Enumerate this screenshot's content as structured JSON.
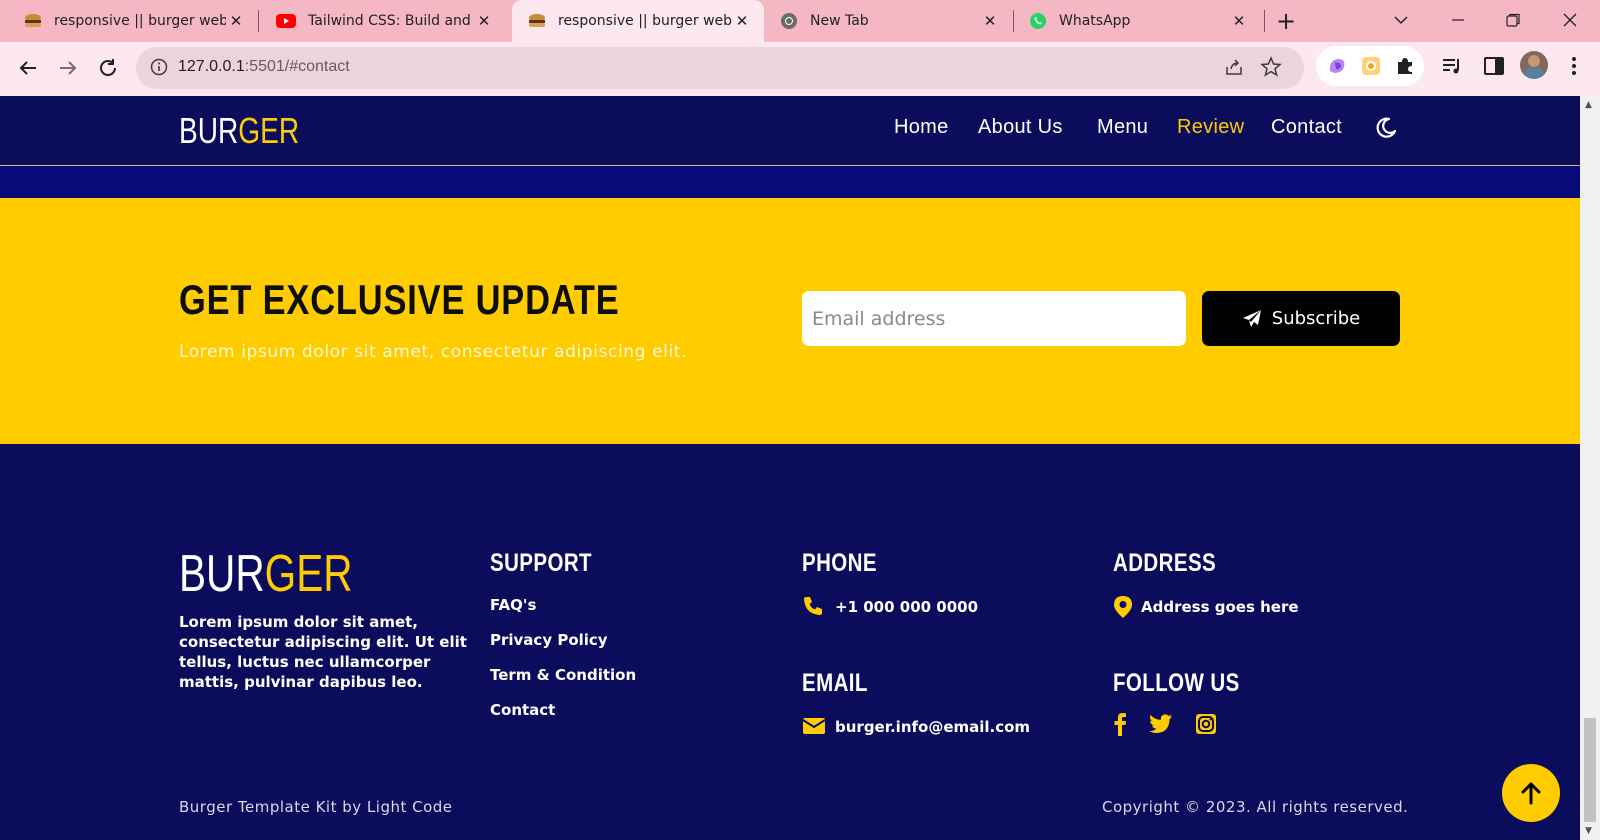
{
  "browser": {
    "tabs": [
      {
        "title": "responsive || burger website",
        "icon": "burger-favicon"
      },
      {
        "title": "Tailwind CSS: Build and Deploy",
        "icon": "youtube-favicon"
      },
      {
        "title": "responsive || burger website",
        "icon": "burger-favicon",
        "active": true
      },
      {
        "title": "New Tab",
        "icon": "chrome-favicon"
      },
      {
        "title": "WhatsApp",
        "icon": "whatsapp-favicon"
      }
    ],
    "url_host": "127.0.0.1",
    "url_path": ":5501/#contact"
  },
  "header": {
    "logo_main": "BUR",
    "logo_accent": "GER",
    "nav": [
      "Home",
      "About Us",
      "Menu",
      "Review",
      "Contact"
    ],
    "active_nav": "Review"
  },
  "subscribe": {
    "title": "GET EXCLUSIVE UPDATE",
    "text": "Lorem ipsum dolor sit amet, consectetur adipiscing elit.",
    "placeholder": "Email address",
    "button": "Subscribe"
  },
  "footer": {
    "logo_main": "BUR",
    "logo_accent": "GER",
    "about": "Lorem ipsum dolor sit amet, consectetur adipiscing elit. Ut elit tellus, luctus nec ullamcorper mattis, pulvinar dapibus leo.",
    "support_title": "SUPPORT",
    "support_links": [
      "FAQ's",
      "Privacy Policy",
      "Term & Condition",
      "Contact"
    ],
    "phone_title": "PHONE",
    "phone": "+1 000 000 0000",
    "email_title": "EMAIL",
    "email": "burger.info@email.com",
    "address_title": "ADDRESS",
    "address": "Address goes here",
    "follow_title": "FOLLOW US",
    "credit": "Burger Template Kit by Light Code",
    "copyright": "Copyright © 2023. All rights reserved."
  },
  "colors": {
    "navy": "#0b0c5b",
    "yellow": "#ffcc00",
    "black": "#000000"
  }
}
